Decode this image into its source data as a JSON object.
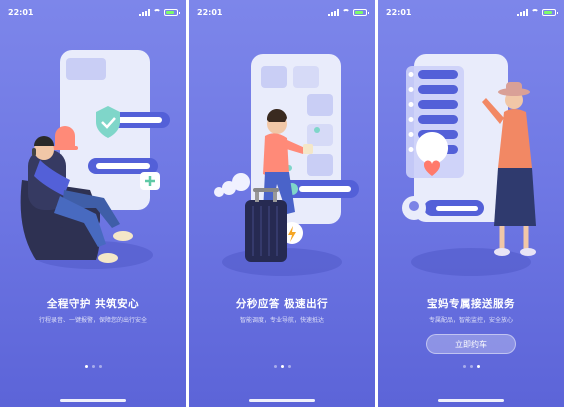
{
  "screens": [
    {
      "status": {
        "time": "22:01"
      },
      "illustration": "safety-seat-illustration",
      "title": "全程守护  共筑安心",
      "subtitle": "行程录音、一键报警，保障您的出行安全",
      "active_dot": 0
    },
    {
      "status": {
        "time": "22:01"
      },
      "illustration": "traveler-luggage-illustration",
      "title": "分秒应答  极速出行",
      "subtitle": "智能调度，专业导航，快速抵达",
      "active_dot": 1
    },
    {
      "status": {
        "time": "22:01"
      },
      "illustration": "exclusive-service-illustration",
      "title": "宝妈专属接送服务",
      "subtitle": "专属配品，智能监控，安全放心",
      "cta_label": "立即约车",
      "active_dot": 2
    }
  ],
  "colors": {
    "bg_top": "#7d86ea",
    "bg_bottom": "#5c64d8",
    "accent": "#5360d8"
  }
}
